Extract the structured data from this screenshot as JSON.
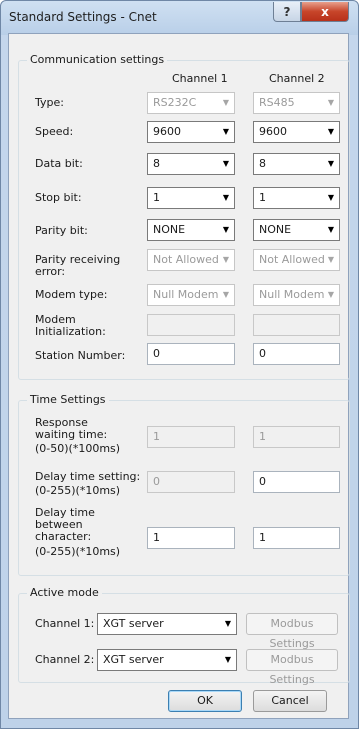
{
  "window": {
    "title": "Standard Settings - Cnet",
    "help_icon": "?",
    "close_icon": "x"
  },
  "communication": {
    "title": "Communication settings",
    "channel1_header": "Channel 1",
    "channel2_header": "Channel 2",
    "type_label": "Type:",
    "type_ch1": "RS232C",
    "type_ch2": "RS485",
    "speed_label": "Speed:",
    "speed_ch1": "9600",
    "speed_ch2": "9600",
    "databit_label": "Data bit:",
    "databit_ch1": "8",
    "databit_ch2": "8",
    "stopbit_label": "Stop bit:",
    "stopbit_ch1": "1",
    "stopbit_ch2": "1",
    "parity_label": "Parity bit:",
    "parity_ch1": "NONE",
    "parity_ch2": "NONE",
    "parity_err_label_1": "Parity receiving",
    "parity_err_label_2": "error:",
    "parity_err_ch1": "Not Allowed",
    "parity_err_ch2": "Not Allowed",
    "modem_type_label": "Modem type:",
    "modem_type_ch1": "Null Modem",
    "modem_type_ch2": "Null Modem",
    "modem_init_label_1": "Modem",
    "modem_init_label_2": "Initialization:",
    "modem_init_ch1": "",
    "modem_init_ch2": "",
    "station_label": "Station Number:",
    "station_ch1": "0",
    "station_ch2": "0"
  },
  "time": {
    "title": "Time Settings",
    "response_label_1": "Response",
    "response_label_2": "waiting time:",
    "response_label_3": "(0-50)(*100ms)",
    "response_ch1": "1",
    "response_ch2": "1",
    "delay_label_1": "Delay time setting:",
    "delay_label_2": "(0-255)(*10ms)",
    "delay_ch1": "0",
    "delay_ch2": "0",
    "between_label_1": "Delay time",
    "between_label_2": "between",
    "between_label_3": "character:",
    "between_label_4": "(0-255)(*10ms)",
    "between_ch1": "1",
    "between_ch2": "1"
  },
  "active": {
    "title": "Active mode",
    "ch1_label": "Channel 1:",
    "ch1_mode": "XGT server",
    "ch2_label": "Channel 2:",
    "ch2_mode": "XGT server",
    "modbus1": "Modbus Settings",
    "modbus2": "Modbus Settings"
  },
  "footer": {
    "ok": "OK",
    "cancel": "Cancel"
  },
  "dropdown_arrow": "▼",
  "colors": {
    "accent": "#3c7fb1",
    "close": "#c7452a",
    "frame": "#b9cfe8"
  }
}
